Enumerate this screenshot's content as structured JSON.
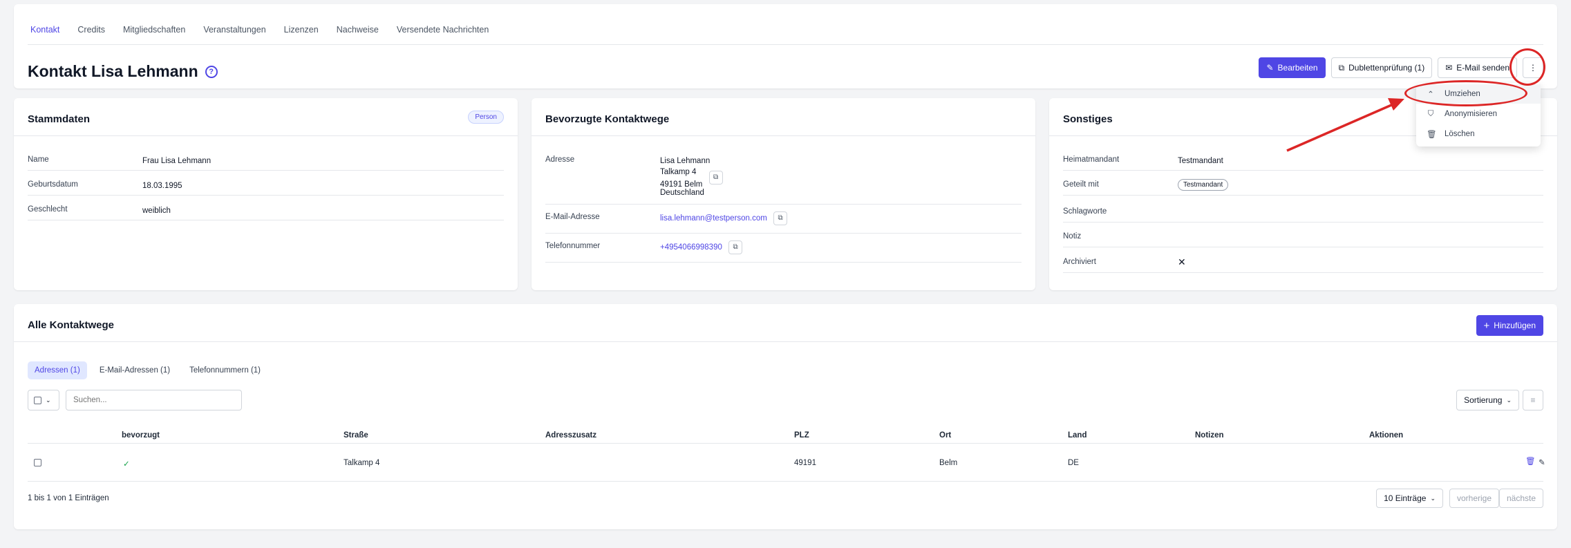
{
  "tabs": [
    "Kontakt",
    "Credits",
    "Mitgliedschaften",
    "Veranstaltungen",
    "Lizenzen",
    "Nachweise",
    "Versendete Nachrichten"
  ],
  "page_title": "Kontakt Lisa Lehmann",
  "actions": {
    "edit": "Bearbeiten",
    "duplicates": "Dublettenprüfung (1)",
    "send_email": "E-Mail senden"
  },
  "menu": {
    "move": "Umziehen",
    "anonymize": "Anonymisieren",
    "delete": "Löschen"
  },
  "stammdaten": {
    "title": "Stammdaten",
    "badge": "Person",
    "rows": [
      {
        "label": "Name",
        "value": "Frau Lisa Lehmann"
      },
      {
        "label": "Geburtsdatum",
        "value": "18.03.1995"
      },
      {
        "label": "Geschlecht",
        "value": "weiblich"
      }
    ]
  },
  "kontaktwege": {
    "title": "Bevorzugte Kontaktwege",
    "address_label": "Adresse",
    "address_lines": [
      "Lisa Lehmann",
      "Talkamp 4",
      "49191 Belm",
      "Deutschland"
    ],
    "email_label": "E-Mail-Adresse",
    "email": "lisa.lehmann@testperson.com",
    "phone_label": "Telefonnummer",
    "phone": "+4954066998390"
  },
  "sonstiges": {
    "title": "Sonstiges",
    "home_label": "Heimatmandant",
    "home_value": "Testmandant",
    "shared_label": "Geteilt mit",
    "shared_value": "Testmandant",
    "keywords_label": "Schlagworte",
    "note_label": "Notiz",
    "archived_label": "Archiviert"
  },
  "alle": {
    "title": "Alle Kontaktwege",
    "add": "Hinzufügen",
    "sub_tabs": [
      "Adressen (1)",
      "E-Mail-Adressen (1)",
      "Telefonnummern (1)"
    ],
    "search_placeholder": "Suchen...",
    "sort": "Sortierung",
    "columns": [
      "bevorzugt",
      "Straße",
      "Adresszusatz",
      "PLZ",
      "Ort",
      "Land",
      "Notizen",
      "Aktionen"
    ],
    "row": {
      "street": "Talkamp 4",
      "zip": "49191",
      "city": "Belm",
      "country": "DE"
    },
    "summary": "1 bis 1 von 1 Einträgen",
    "page_size": "10 Einträge",
    "prev": "vorherige",
    "next": "nächste"
  },
  "colors": {
    "accent": "#4f46e5",
    "annotation": "#dc2626"
  }
}
